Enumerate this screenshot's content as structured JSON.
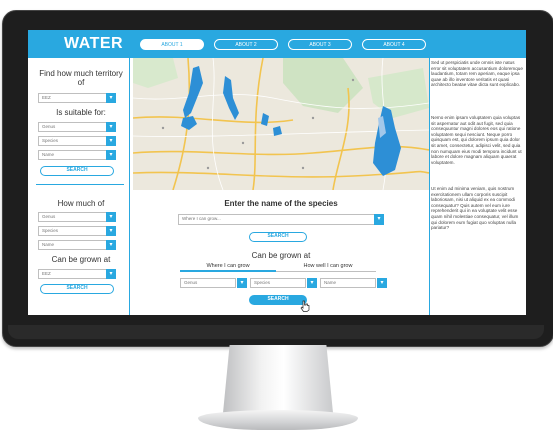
{
  "app": {
    "title": "WATER"
  },
  "nav": {
    "tabs": [
      {
        "label": "ABOUT 1",
        "active": true
      },
      {
        "label": "ABOUT 2",
        "active": false
      },
      {
        "label": "ABOUT 3",
        "active": false
      },
      {
        "label": "ABOUT 4",
        "active": false
      }
    ]
  },
  "sidebar": {
    "territory_title": "Find how much territory of",
    "territory_select": "EEZ",
    "suitable_title": "Is suitable for:",
    "genus_select": "Genus",
    "species_select": "Species",
    "name_select": "Name",
    "search_label": "SEARCH",
    "how_much_title": "How much of",
    "how_genus": "Genus",
    "how_species": "Species",
    "how_name": "Name",
    "grown_title": "Can be grown at",
    "grown_select": "EEZ",
    "search2_label": "SEARCH"
  },
  "main": {
    "species_title": "Enter the name of the species",
    "species_placeholder": "Where I can grow...",
    "search_label": "SEARCH",
    "grown_title": "Can be grown at",
    "subtab_where": "Where I can grow",
    "subtab_how": "How well I can grow",
    "genus": "Genus",
    "species": "Species",
    "name": "Name",
    "search2_label": "SEARCH"
  },
  "right": {
    "para1": "Sed ut perspiciatis unde omnis iste natus error sit voluptatem accusantium doloremque laudantium, totam rem aperiam, eaque ipsa quae ab illo inventore veritatis et quasi architecto beatae vitae dicta sunt explicabo.",
    "para2": "Nemo enim ipsam voluptatem quia voluptas sit aspernatur aut odit aut fugit, sed quia consequuntur magni dolores eos qui ratione voluptatem sequi nesciunt. Neque porro quisquam est, qui dolorem ipsum quia dolor sit amet, consectetur, adipisci velit, sed quia non numquam eius modi tempora incidunt ut labore et dolore magnam aliquam quaerat voluptatem.",
    "para3": "Ut enim ad minima veniam, quis nostrum exercitationem ullam corporis suscipit laboriosam, nisi ut aliquid ex ea commodi consequatur? Quis autem vel eum iure reprehenderit qui in ea voluptate velit esse quam nihil molestiae consequatur, vel illum qui dolorem eum fugiat quo voluptas nulla pariatur?"
  },
  "colors": {
    "accent": "#29a8e0",
    "bezel": "#1e1e1e",
    "water": "#2d8fd6"
  },
  "icons": {
    "dropdown": "chevron-down-icon",
    "cursor": "hand-pointer-icon"
  }
}
